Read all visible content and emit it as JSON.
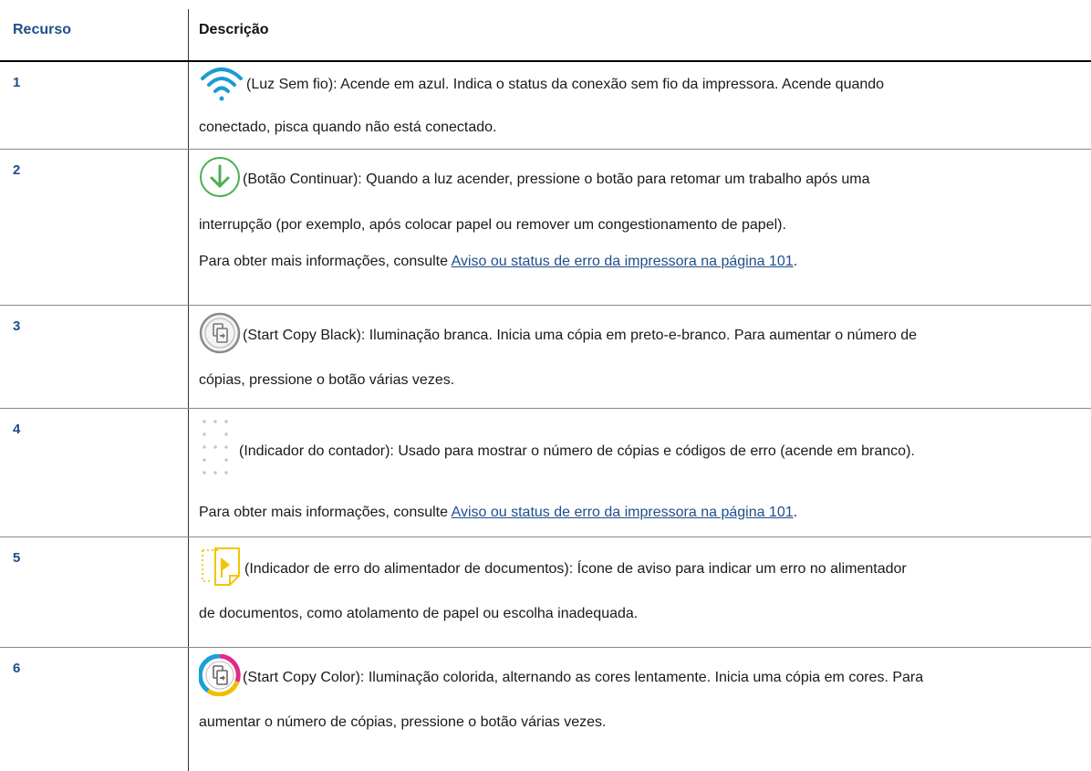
{
  "header": {
    "col1": "Recurso",
    "col2": "Descrição"
  },
  "rows": [
    {
      "num": "1",
      "icon": "wifi-icon",
      "line1": "(Luz Sem fio): Acende em azul. Indica o status da conexão sem fio da impressora. Acende quando",
      "line2": "conectado, pisca quando não está conectado."
    },
    {
      "num": "2",
      "icon": "resume-icon",
      "line1": "(Botão Continuar): Quando a luz acender, pressione o botão para retomar um trabalho após uma",
      "line2": "interrupção (por exemplo, após colocar papel ou remover um congestionamento de papel).",
      "more_prefix": "Para obter mais informações, consulte ",
      "more_link": "Aviso ou status de erro da impressora na página 101",
      "more_suffix": "."
    },
    {
      "num": "3",
      "icon": "copy-black-icon",
      "line1": "(Start Copy Black): Iluminação branca. Inicia uma cópia em preto-e-branco. Para aumentar o número de",
      "line2": "cópias, pressione o botão várias vezes."
    },
    {
      "num": "4",
      "icon": "counter-display-icon",
      "line1": "(Indicador do contador): Usado para mostrar o número de cópias e códigos de erro (acende em branco).",
      "more_prefix": "Para obter mais informações, consulte ",
      "more_link": "Aviso ou status de erro da impressora na página 101",
      "more_suffix": "."
    },
    {
      "num": "5",
      "icon": "document-feeder-error-icon",
      "line1": "(Indicador de erro do alimentador de documentos): Ícone de aviso para indicar um erro no alimentador",
      "line2": "de documentos, como atolamento de papel ou escolha inadequada."
    },
    {
      "num": "6",
      "icon": "copy-color-icon",
      "line1": "(Start Copy Color): Iluminação colorida, alternando as cores lentamente. Inicia uma cópia em cores. Para",
      "line2": "aumentar o número de cópias, pressione o botão várias vezes."
    }
  ],
  "colors": {
    "accent": "#1f4e8c",
    "wifi": "#1a9bd7",
    "resume": "#4caf50",
    "feeder_error": "#f5c400"
  }
}
